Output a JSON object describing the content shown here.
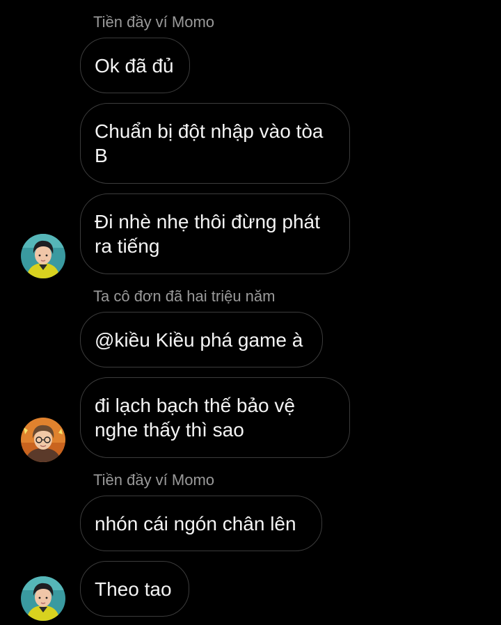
{
  "messages": [
    {
      "sender": "Tiền đầy ví Momo"
    },
    {
      "text": "Ok đã đủ"
    },
    {
      "text": "Chuẩn bị đột nhập vào tòa B"
    },
    {
      "text": "Đi nhè nhẹ thôi đừng phát ra tiếng"
    },
    {
      "sender": "Ta cô đơn đã hai triệu năm"
    },
    {
      "text": "@kiều Kiều phá game à"
    },
    {
      "text": "đi lạch bạch thế bảo vệ nghe thấy thì sao"
    },
    {
      "sender": "Tiền đầy ví Momo"
    },
    {
      "text": "nhón cái ngón chân lên"
    },
    {
      "text": "Theo tao"
    }
  ],
  "colors": {
    "background": "#000000",
    "bubble_border": "#3c3c3c",
    "sender_name": "#9a9a9a",
    "message_text": "#f4f4f4"
  },
  "avatars": [
    "avatar-boy-yellow",
    "avatar-boy-orange",
    "avatar-boy-yellow"
  ]
}
